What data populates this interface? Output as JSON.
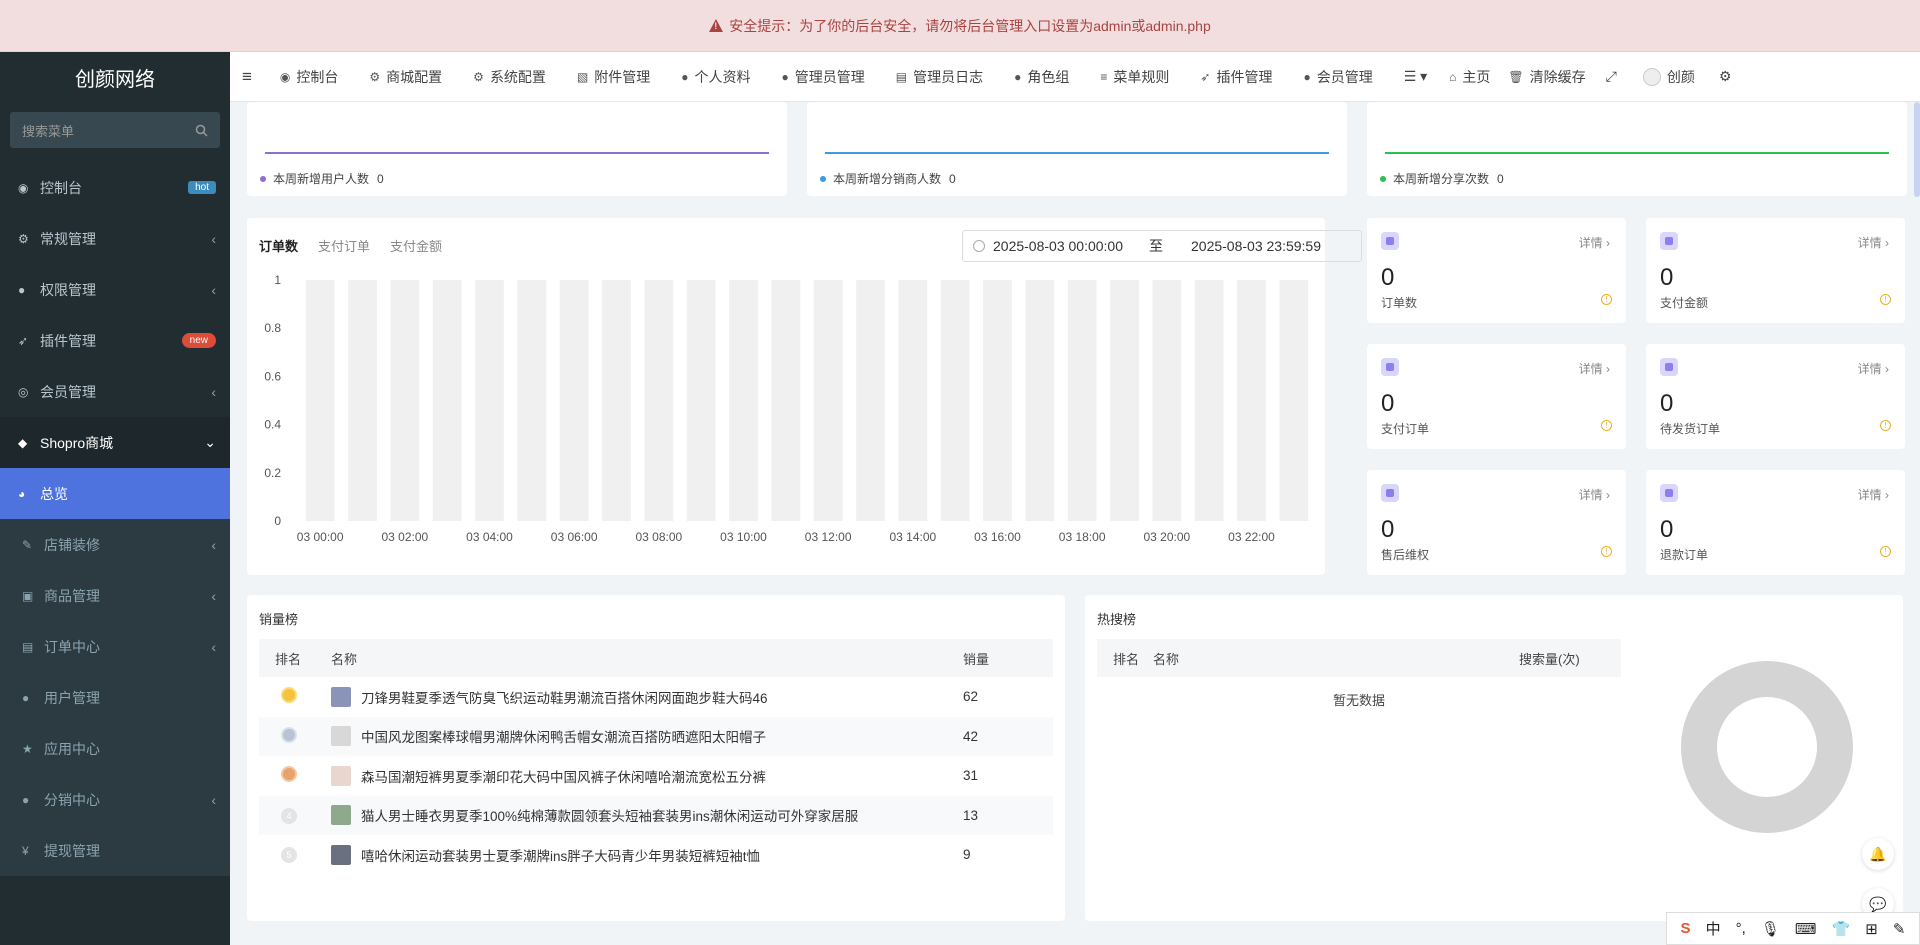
{
  "alert": {
    "text": "安全提示：为了你的后台安全，请勿将后台管理入口设置为admin或admin.php"
  },
  "sidebar": {
    "logo": "创颜网络",
    "search_placeholder": "搜索菜单",
    "items": [
      {
        "label": "控制台",
        "icon": "dashboard-icon",
        "badge": "hot"
      },
      {
        "label": "常规管理",
        "icon": "cogs-icon"
      },
      {
        "label": "权限管理",
        "icon": "group-icon"
      },
      {
        "label": "插件管理",
        "icon": "rocket-icon",
        "badge": "new"
      },
      {
        "label": "会员管理",
        "icon": "user-circle-icon"
      },
      {
        "label": "Shopro商城",
        "icon": "dropbox-icon"
      },
      {
        "label": "总览",
        "icon": "pie-chart-icon"
      },
      {
        "label": "店铺装修",
        "icon": "brush-icon"
      },
      {
        "label": "商品管理",
        "icon": "archive-icon"
      },
      {
        "label": "订单中心",
        "icon": "file-icon"
      },
      {
        "label": "用户管理",
        "icon": "user-icon"
      },
      {
        "label": "应用中心",
        "icon": "star-icon"
      },
      {
        "label": "分销中心",
        "icon": "users-icon"
      },
      {
        "label": "提现管理",
        "icon": "yen-icon"
      }
    ]
  },
  "topbar": {
    "items": [
      {
        "label": "控制台",
        "icon": "dashboard-icon"
      },
      {
        "label": "商城配置",
        "icon": "cogs-icon"
      },
      {
        "label": "系统配置",
        "icon": "gear-icon"
      },
      {
        "label": "附件管理",
        "icon": "file-image-icon"
      },
      {
        "label": "个人资料",
        "icon": "user-icon"
      },
      {
        "label": "管理员管理",
        "icon": "user-icon"
      },
      {
        "label": "管理员日志",
        "icon": "list-alt-icon"
      },
      {
        "label": "角色组",
        "icon": "group-icon"
      },
      {
        "label": "菜单规则",
        "icon": "bars-icon"
      },
      {
        "label": "插件管理",
        "icon": "rocket-icon"
      },
      {
        "label": "会员管理",
        "icon": "user-icon"
      }
    ],
    "home": "主页",
    "clear_cache": "清除缓存",
    "username": "创颜"
  },
  "mini_cards": [
    {
      "label": "本周新增用户人数",
      "value": "0",
      "color": "#8d6fd1"
    },
    {
      "label": "本周新增分销商人数",
      "value": "0",
      "color": "#3b9ae1"
    },
    {
      "label": "本周新增分享次数",
      "value": "0",
      "color": "#27c24c"
    }
  ],
  "order_chart": {
    "tabs": [
      "订单数",
      "支付订单",
      "支付金额"
    ],
    "date_start": "2025-08-03 00:00:00",
    "date_sep": "至",
    "date_end": "2025-08-03 23:59:59"
  },
  "chart_data": {
    "type": "bar",
    "title": "",
    "xlabel": "",
    "ylabel": "",
    "ylim": [
      0,
      1
    ],
    "yticks": [
      "0",
      "0.2",
      "0.4",
      "0.6",
      "0.8",
      "1"
    ],
    "x_tick_labels": [
      "03 00:00",
      "03 02:00",
      "03 04:00",
      "03 06:00",
      "03 08:00",
      "03 10:00",
      "03 12:00",
      "03 14:00",
      "03 16:00",
      "03 18:00",
      "03 20:00",
      "03 22:00"
    ],
    "categories": [
      "03 00:00",
      "03 01:00",
      "03 02:00",
      "03 03:00",
      "03 04:00",
      "03 05:00",
      "03 06:00",
      "03 07:00",
      "03 08:00",
      "03 09:00",
      "03 10:00",
      "03 11:00",
      "03 12:00",
      "03 13:00",
      "03 14:00",
      "03 15:00",
      "03 16:00",
      "03 17:00",
      "03 18:00",
      "03 19:00",
      "03 20:00",
      "03 21:00",
      "03 22:00",
      "03 23:00"
    ],
    "values": [
      0,
      0,
      0,
      0,
      0,
      0,
      0,
      0,
      0,
      0,
      0,
      0,
      0,
      0,
      0,
      0,
      0,
      0,
      0,
      0,
      0,
      0,
      0,
      0
    ],
    "background_bar_color": "#f0f0f0",
    "grid": false
  },
  "stats": [
    {
      "label": "订单数",
      "value": "0",
      "detail": "详情"
    },
    {
      "label": "支付金额",
      "value": "0",
      "detail": "详情"
    },
    {
      "label": "支付订单",
      "value": "0",
      "detail": "详情"
    },
    {
      "label": "待发货订单",
      "value": "0",
      "detail": "详情"
    },
    {
      "label": "售后维权",
      "value": "0",
      "detail": "详情"
    },
    {
      "label": "退款订单",
      "value": "0",
      "detail": "详情"
    }
  ],
  "sales_rank": {
    "title": "销量榜",
    "headers": [
      "排名",
      "名称",
      "销量"
    ],
    "rows": [
      {
        "name": "刀锋男鞋夏季透气防臭飞织运动鞋男潮流百搭休闲网面跑步鞋大码46",
        "sales": "62",
        "badge_color": "#f5c33b",
        "thumb": "#8a93b8"
      },
      {
        "name": "中国风龙图案棒球帽男潮牌休闲鸭舌帽女潮流百搭防晒遮阳太阳帽子",
        "sales": "42",
        "badge_color": "#b8c3d6",
        "thumb": "#d8d8d8"
      },
      {
        "name": "森马国潮短裤男夏季潮印花大码中国风裤子休闲嘻哈潮流宽松五分裤",
        "sales": "31",
        "badge_color": "#e8a26a",
        "thumb": "#e8d6cf"
      },
      {
        "name": "猫人男士睡衣男夏季100%纯棉薄款圆领套头短袖套装男ins潮休闲运动可外穿家居服",
        "sales": "13",
        "badge_rank": "4",
        "thumb": "#8fa98a"
      },
      {
        "name": "嘻哈休闲运动套装男士夏季潮牌ins胖子大码青少年男装短裤短袖t恤",
        "sales": "9",
        "badge_rank": "5",
        "thumb": "#6a7080"
      }
    ]
  },
  "hot_search": {
    "title": "热搜榜",
    "headers": [
      "排名",
      "名称",
      "搜索量(次)"
    ],
    "empty": "暂无数据"
  },
  "ime": {
    "lang": "中"
  }
}
